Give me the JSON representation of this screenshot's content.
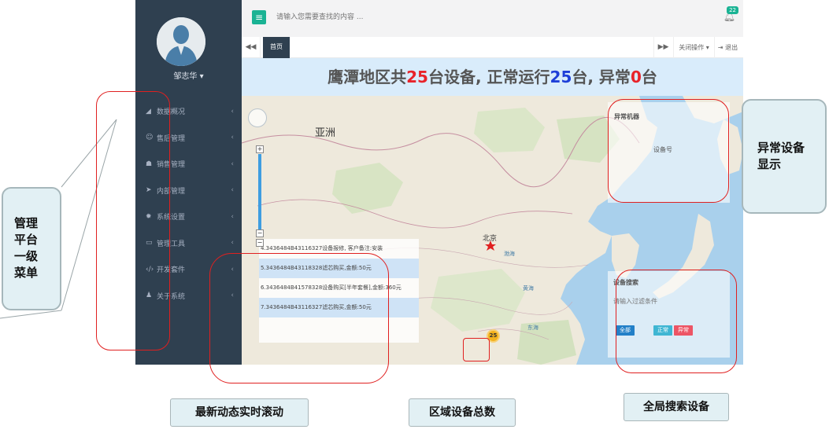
{
  "user": {
    "name": "邹志华 ▾"
  },
  "sidebar": {
    "items": [
      {
        "icon": "◢",
        "label": "数据概况"
      },
      {
        "icon": "☺",
        "label": "售后管理"
      },
      {
        "icon": "☗",
        "label": "销售管理"
      },
      {
        "icon": "➤",
        "label": "内部管理"
      },
      {
        "icon": "✹",
        "label": "系统设置"
      },
      {
        "icon": "▭",
        "label": "管理工具"
      },
      {
        "icon": "‹/›",
        "label": "开发套件"
      },
      {
        "icon": "♟",
        "label": "关于系统"
      }
    ],
    "arrow": "‹"
  },
  "topbar": {
    "search_placeholder": "请输入您需要查找的内容 ...",
    "notification_count": "22",
    "menu_icon": "≡"
  },
  "tabs": {
    "back": "◀◀",
    "home": "首页",
    "forward": "▶▶",
    "close_ops": "关闭操作 ▾",
    "logout": "⇥ 退出"
  },
  "banner": {
    "prefix": "鹰潭地区共",
    "total": "25",
    "mid1": "台设备, 正常运行",
    "normal": "25",
    "mid2": "台, 异常",
    "abnormal": "0",
    "suffix": "台"
  },
  "map": {
    "labels": {
      "asia": "亚洲",
      "beijing": "北京",
      "bohai": "渤海",
      "yellow_sea": "黄海",
      "east_sea": "东海"
    },
    "cluster_count": "25",
    "zoom_plus": "+",
    "zoom_minus": "−"
  },
  "log": {
    "rows": [
      "4.3436484B43116327设备报修, 客户备注:安装",
      "5.3436484B43118328滤芯购买,金额:50元",
      "6.3436484B41578328设备购买[半年套餐],金额:360元",
      "7.3436484B43116327滤芯购买,金额:50元"
    ]
  },
  "abnormal_panel": {
    "title": "异常机器",
    "column": "设备号"
  },
  "search_panel": {
    "title": "设备搜索",
    "placeholder": "请输入过滤条件",
    "btn_all": "全部",
    "btn_normal": "正常",
    "btn_abnormal": "异常"
  },
  "annotations": {
    "menu_callout": "管理\n平台\n一级\n菜单",
    "abnormal_callout": "异常设备\n显示",
    "log_tag": "最新动态实时滚动",
    "total_tag": "区域设备总数",
    "search_tag": "全局搜索设备"
  }
}
